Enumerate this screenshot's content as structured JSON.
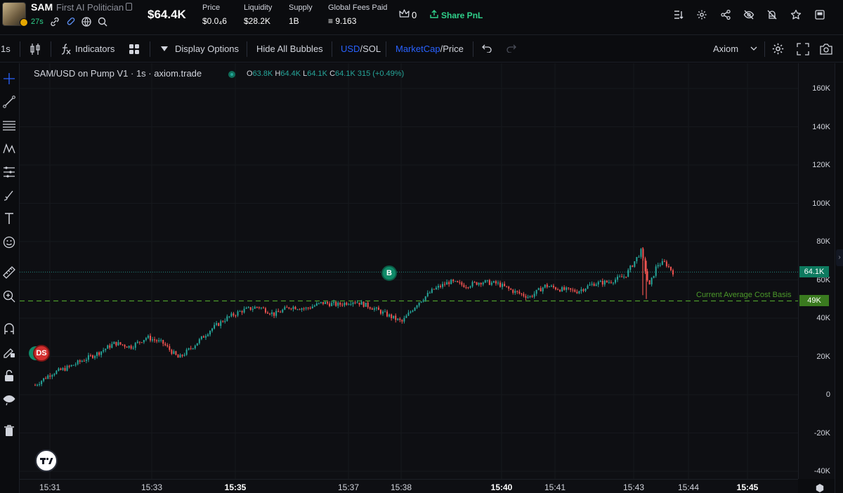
{
  "token": {
    "ticker": "SAM",
    "name": "First AI Politician",
    "age": "27s",
    "market_cap": "$64.4K"
  },
  "stats": [
    {
      "label": "Price",
      "value": "$0.0₄6"
    },
    {
      "label": "Liquidity",
      "value": "$28.2K"
    },
    {
      "label": "Supply",
      "value": "1B"
    },
    {
      "label": "Global Fees Paid",
      "value": "≡ 9.163"
    }
  ],
  "top_actions": {
    "crown_count": "0",
    "share_label": "Share PnL"
  },
  "toolbar": {
    "interval": "1s",
    "indicators": "Indicators",
    "display_options": "Display Options",
    "hide_bubbles": "Hide All Bubbles",
    "currency_usd": "USD",
    "currency_sep": "/",
    "currency_sol": "SOL",
    "metric_mcap": "MarketCap",
    "metric_sep": "/",
    "metric_price": "Price",
    "source": "Axiom"
  },
  "legend": {
    "title": "SAM/USD on Pump V1 · 1s · axiom.trade",
    "o_key": "O",
    "o_val": "63.8K",
    "h_key": "H",
    "h_val": "64.4K",
    "l_key": "L",
    "l_val": "64.1K",
    "c_key": "C",
    "c_val": "64.1K 315 (+0.49%)"
  },
  "annotations": {
    "cost_basis_label": "Current Average Cost Basis",
    "cost_basis_tag": "49K",
    "last_price_tag": "64.1K",
    "buy_bubble": "B",
    "ds_bubble": "DS"
  },
  "colors": {
    "up": "#26a69a",
    "down": "#ef5350",
    "accent_blue": "#2962ff",
    "green": "#2fd18b",
    "cost_line": "#4c9a2a"
  },
  "chart_data": {
    "type": "candlestick",
    "y_ticks": [
      "160K",
      "140K",
      "120K",
      "100K",
      "80K",
      "60K",
      "40K",
      "20K",
      "0",
      "-20K",
      "-40K"
    ],
    "x_ticks": [
      {
        "label": "15:31",
        "bold": false
      },
      {
        "label": "15:33",
        "bold": false
      },
      {
        "label": "15:35",
        "bold": true
      },
      {
        "label": "15:37",
        "bold": false
      },
      {
        "label": "15:38",
        "bold": false
      },
      {
        "label": "15:40",
        "bold": true
      },
      {
        "label": "15:41",
        "bold": false
      },
      {
        "label": "15:43",
        "bold": false
      },
      {
        "label": "15:44",
        "bold": false
      },
      {
        "label": "15:45",
        "bold": true
      }
    ],
    "ylim": [
      -45000,
      170000
    ],
    "last_price": 64100,
    "avg_cost_basis": 49000,
    "path": [
      [
        0,
        5000
      ],
      [
        0.04,
        11000
      ],
      [
        0.08,
        14000
      ],
      [
        0.12,
        18000
      ],
      [
        0.16,
        22000
      ],
      [
        0.2,
        27000
      ],
      [
        0.24,
        25000
      ],
      [
        0.28,
        30000
      ],
      [
        0.32,
        27000
      ],
      [
        0.36,
        19000
      ],
      [
        0.4,
        26000
      ],
      [
        0.44,
        34000
      ],
      [
        0.48,
        40000
      ],
      [
        0.52,
        44000
      ],
      [
        0.56,
        46000
      ],
      [
        0.6,
        42000
      ],
      [
        0.64,
        46000
      ],
      [
        0.68,
        45000
      ],
      [
        0.72,
        48000
      ],
      [
        0.76,
        47000
      ],
      [
        0.8,
        49000
      ],
      [
        0.84,
        46000
      ],
      [
        0.88,
        42000
      ],
      [
        0.92,
        38000
      ],
      [
        0.96,
        48000
      ],
      [
        1.0,
        55000
      ],
      [
        1.04,
        59000
      ],
      [
        1.08,
        57000
      ],
      [
        1.12,
        59000
      ],
      [
        1.16,
        58000
      ],
      [
        1.2,
        54000
      ],
      [
        1.24,
        51000
      ],
      [
        1.28,
        57000
      ],
      [
        1.32,
        55000
      ],
      [
        1.36,
        54000
      ],
      [
        1.4,
        58000
      ],
      [
        1.44,
        59000
      ],
      [
        1.48,
        62000
      ],
      [
        1.52,
        75000
      ],
      [
        1.54,
        56000
      ],
      [
        1.56,
        68000
      ],
      [
        1.58,
        69000
      ],
      [
        1.6,
        64100
      ]
    ]
  }
}
